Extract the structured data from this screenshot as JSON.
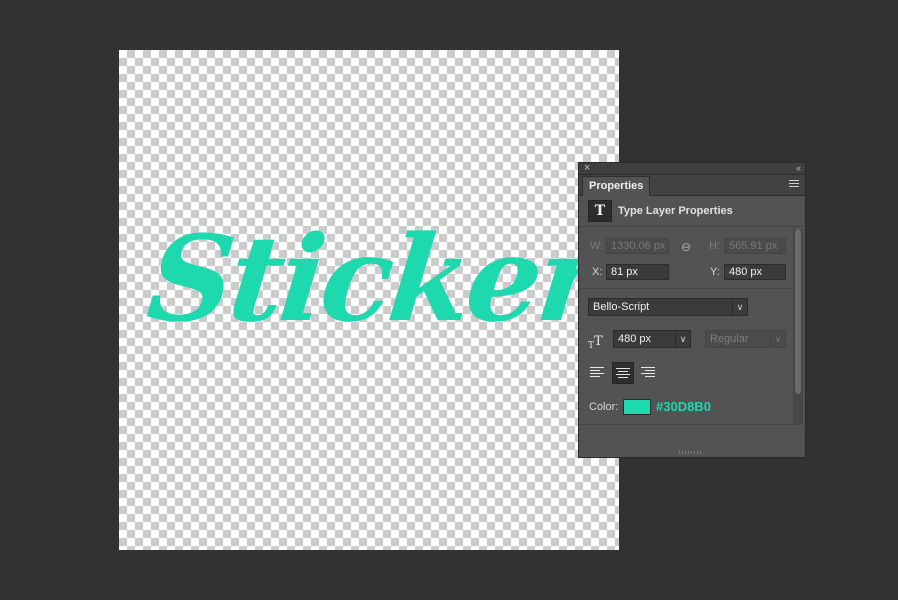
{
  "canvas": {
    "text": "Sticker",
    "text_color": "#1ED8AE"
  },
  "panel": {
    "tab_label": "Properties",
    "header_title": "Type Layer Properties",
    "type_icon_glyph": "T",
    "transform": {
      "w_label": "W:",
      "w_value": "1330.06 px",
      "h_label": "H:",
      "h_value": "565.91 px",
      "x_label": "X:",
      "x_value": "81 px",
      "y_label": "Y:",
      "y_value": "480 px"
    },
    "font_family": "Bello-Script",
    "font_size": "480 px",
    "font_style": "Regular",
    "color_label": "Color:",
    "color_hex": "#30D8B0",
    "color_value": "#1ED8AE"
  }
}
